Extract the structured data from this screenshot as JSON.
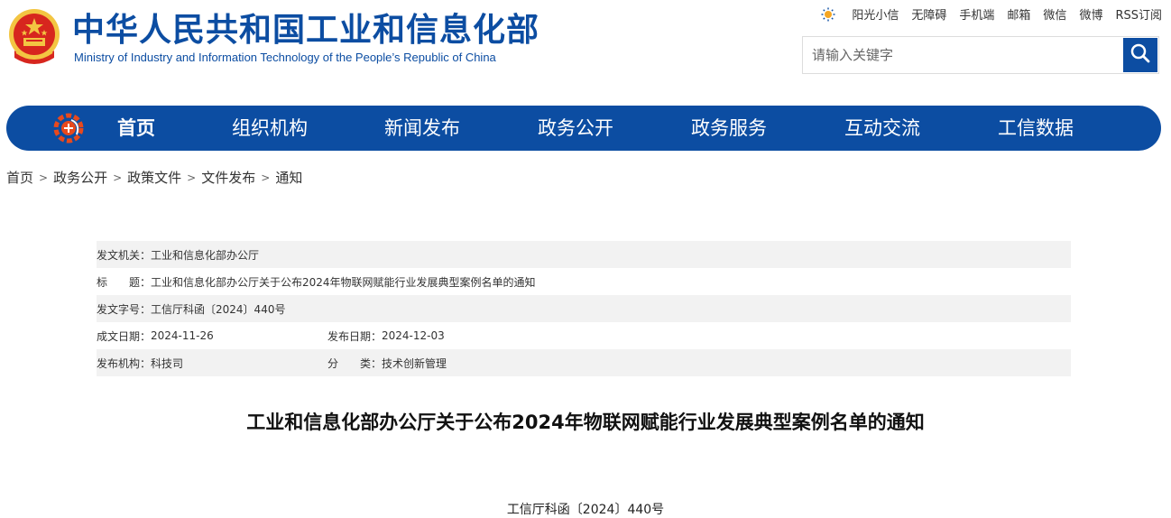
{
  "header": {
    "title_cn": "中华人民共和国工业和信息化部",
    "title_en": "Ministry of Industry and Information Technology of the People’s Republic of China",
    "emblem_icon": "national-emblem-icon"
  },
  "top_links": [
    {
      "label": "阳光小信",
      "icon": "sun-icon"
    },
    {
      "label": "无障碍"
    },
    {
      "label": "手机端"
    },
    {
      "label": "邮箱"
    },
    {
      "label": "微信"
    },
    {
      "label": "微博"
    },
    {
      "label": "RSS订阅"
    }
  ],
  "search": {
    "placeholder": "请输入关键字",
    "icon": "search-icon"
  },
  "nav": {
    "items": [
      {
        "label": "首页",
        "active": true
      },
      {
        "label": "组织机构"
      },
      {
        "label": "新闻发布"
      },
      {
        "label": "政务公开"
      },
      {
        "label": "政务服务"
      },
      {
        "label": "互动交流"
      },
      {
        "label": "工信数据"
      }
    ]
  },
  "breadcrumb": [
    "首页",
    "政务公开",
    "政策文件",
    "文件发布",
    "通知"
  ],
  "info": {
    "issuer_label": "发文机关：",
    "issuer": "工业和信息化部办公厅",
    "title_label": "标　　题：",
    "title": "工业和信息化部办公厅关于公布2024年物联网赋能行业发展典型案例名单的通知",
    "docno_label": "发文字号：",
    "docno": "工信厅科函〔2024〕440号",
    "created_label": "成文日期：",
    "created": "2024-11-26",
    "published_label": "发布日期：",
    "published": "2024-12-03",
    "org_label": "发布机构：",
    "org": "科技司",
    "category_label": "分　　类：",
    "category": "技术创新管理"
  },
  "document": {
    "title": "工业和信息化部办公厅关于公布2024年物联网赋能行业发展典型案例名单的通知",
    "number": "工信厅科函〔2024〕440号"
  },
  "colors": {
    "brand_blue": "#0c4da2",
    "emblem_red": "#d7261e",
    "emblem_gold": "#f3c542",
    "row_shade": "#f2f2f2"
  }
}
